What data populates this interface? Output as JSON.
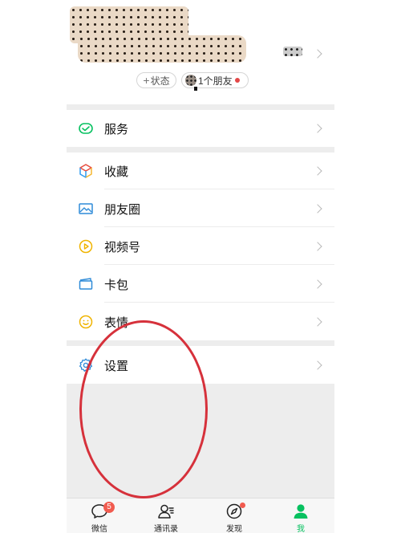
{
  "profile": {
    "status_button": "状态",
    "status_plus": "+",
    "friends_button": "1个朋友"
  },
  "menu": {
    "items": [
      {
        "label": "服务",
        "icon": "service-wallet-icon"
      },
      {
        "label": "收藏",
        "icon": "favorites-cube-icon"
      },
      {
        "label": "朋友圈",
        "icon": "moments-picture-icon"
      },
      {
        "label": "视频号",
        "icon": "channels-play-icon"
      },
      {
        "label": "卡包",
        "icon": "card-wallet-icon"
      },
      {
        "label": "表情",
        "icon": "sticker-smile-icon"
      },
      {
        "label": "设置",
        "icon": "settings-gear-icon"
      }
    ]
  },
  "tabbar": {
    "tabs": [
      {
        "label": "微信",
        "icon": "chat-bubble-icon",
        "badge": "5"
      },
      {
        "label": "通讯录",
        "icon": "contacts-icon"
      },
      {
        "label": "发现",
        "icon": "compass-icon"
      },
      {
        "label": "我",
        "icon": "me-person-icon",
        "active": true
      }
    ]
  },
  "colors": {
    "accent_green": "#07c160",
    "badge_red": "#f15b4f",
    "annotation_red": "#d6313b",
    "separator_gray": "#ededed"
  }
}
